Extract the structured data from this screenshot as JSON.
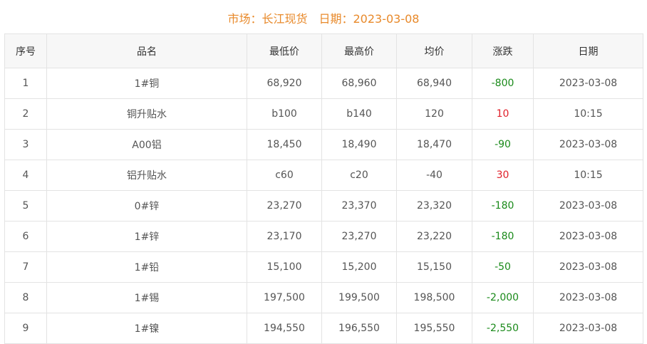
{
  "header": {
    "market_label": "市场：长江现货",
    "date_label": "日期：2023-03-08"
  },
  "table": {
    "columns": [
      "序号",
      "品名",
      "最低价",
      "最高价",
      "均价",
      "涨跌",
      "日期"
    ],
    "rows": [
      {
        "no": "1",
        "name": "1#铜",
        "low": "68,920",
        "high": "68,960",
        "avg": "68,940",
        "change": "-800",
        "date": "2023-03-08"
      },
      {
        "no": "2",
        "name": "铜升贴水",
        "low": "b100",
        "high": "b140",
        "avg": "120",
        "change": "10",
        "date": "10:15"
      },
      {
        "no": "3",
        "name": "A00铝",
        "low": "18,450",
        "high": "18,490",
        "avg": "18,470",
        "change": "-90",
        "date": "2023-03-08"
      },
      {
        "no": "4",
        "name": "铝升贴水",
        "low": "c60",
        "high": "c20",
        "avg": "-40",
        "change": "30",
        "date": "10:15"
      },
      {
        "no": "5",
        "name": "0#锌",
        "low": "23,270",
        "high": "23,370",
        "avg": "23,320",
        "change": "-180",
        "date": "2023-03-08"
      },
      {
        "no": "6",
        "name": "1#锌",
        "low": "23,170",
        "high": "23,270",
        "avg": "23,220",
        "change": "-180",
        "date": "2023-03-08"
      },
      {
        "no": "7",
        "name": "1#铅",
        "low": "15,100",
        "high": "15,200",
        "avg": "15,150",
        "change": "-50",
        "date": "2023-03-08"
      },
      {
        "no": "8",
        "name": "1#锡",
        "low": "197,500",
        "high": "199,500",
        "avg": "198,500",
        "change": "-2,000",
        "date": "2023-03-08"
      },
      {
        "no": "9",
        "name": "1#镍",
        "low": "194,550",
        "high": "196,550",
        "avg": "195,550",
        "change": "-2,550",
        "date": "2023-03-08"
      }
    ]
  },
  "colors": {
    "title": "#e8892a",
    "down": "#1a8a1a",
    "up": "#e0202a",
    "header_bg": "#f7f7f7",
    "border": "#e3e3e3"
  }
}
